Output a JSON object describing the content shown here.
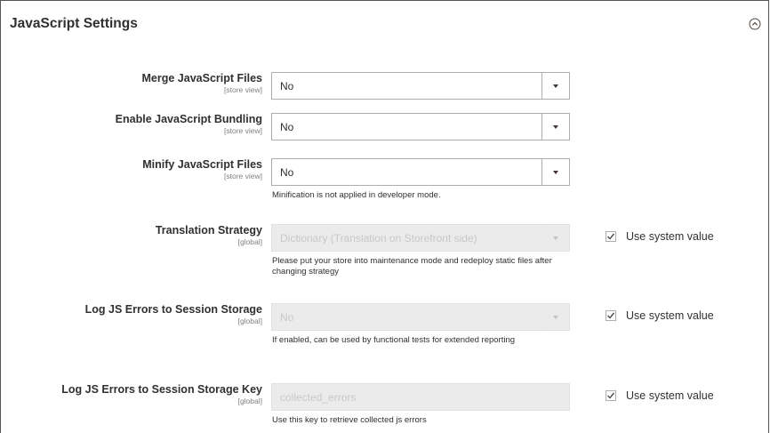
{
  "section": {
    "title": "JavaScript Settings"
  },
  "fields": [
    {
      "label": "Merge JavaScript Files",
      "scope": "[store view]",
      "value": "No",
      "note": ""
    },
    {
      "label": "Enable JavaScript Bundling",
      "scope": "[store view]",
      "value": "No",
      "note": ""
    },
    {
      "label": "Minify JavaScript Files",
      "scope": "[store view]",
      "value": "No",
      "note": "Minification is not applied in developer mode."
    },
    {
      "label": "Translation Strategy",
      "scope": "[global]",
      "value": "Dictionary (Translation on Storefront side)",
      "note": "Please put your store into maintenance mode and redeploy static files after changing strategy",
      "use_system_value": "Use system value",
      "use_system_checked": true
    },
    {
      "label": "Log JS Errors to Session Storage",
      "scope": "[global]",
      "value": "No",
      "note": "If enabled, can be used by functional tests for extended reporting",
      "use_system_value": "Use system value",
      "use_system_checked": true
    },
    {
      "label": "Log JS Errors to Session Storage Key",
      "scope": "[global]",
      "value": "collected_errors",
      "note": "Use this key to retrieve collected js errors",
      "use_system_value": "Use system value",
      "use_system_checked": true
    }
  ]
}
